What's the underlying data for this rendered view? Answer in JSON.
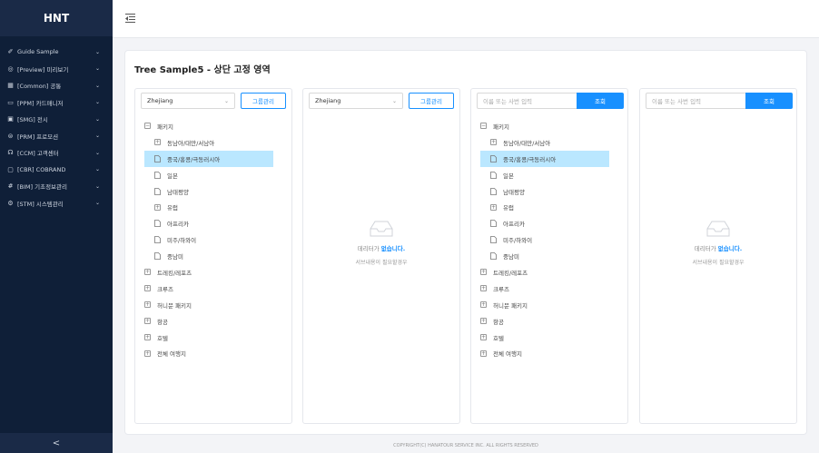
{
  "app": {
    "brand": "HNT",
    "collapse_glyph": "<"
  },
  "sidebar": {
    "items": [
      {
        "icon": "✐",
        "label": "Guide Sample"
      },
      {
        "icon": "◎",
        "label": "[Preview] 미리보기"
      },
      {
        "icon": "▦",
        "label": "[Common] 공통"
      },
      {
        "icon": "▭",
        "label": "[PPM] 카드매니저"
      },
      {
        "icon": "▣",
        "label": "[SMG] 전시"
      },
      {
        "icon": "⊜",
        "label": "[PRM] 프로모션"
      },
      {
        "icon": "☊",
        "label": "[CCM] 고객센터"
      },
      {
        "icon": "▢",
        "label": "[CBR] COBRAND"
      },
      {
        "icon": "#",
        "label": "[BIM] 기초정보관리"
      },
      {
        "icon": "⚙",
        "label": "[STM] 시스템관리"
      }
    ]
  },
  "page": {
    "title": "Tree Sample5 - 상단 고정 영역"
  },
  "panels": {
    "p1": {
      "select_value": "Zhejiang",
      "group_button": "그룹관리"
    },
    "p2": {
      "select_value": "Zhejiang",
      "group_button": "그룹관리"
    },
    "p3": {
      "search_placeholder": "이름 또는 사번 입력",
      "search_button": "조회"
    },
    "p4": {
      "search_placeholder": "이름 또는 사번 입력",
      "search_button": "조회"
    }
  },
  "tree": {
    "root": "패키지",
    "regions": [
      "동남아/대만/서남아",
      "중국/홍콩/극동러시아",
      "일본",
      "남태평양",
      "유럽",
      "아프리카",
      "미주/하와이",
      "중남미"
    ],
    "others": [
      "트레킹/레포츠",
      "크루즈",
      "허니문 패키지",
      "항공",
      "호텔",
      "전체 여행지"
    ]
  },
  "empty_state": {
    "prefix": "데리터가 ",
    "emphasis": "없습니다.",
    "sub": "서브내용이 필요할경우"
  },
  "footer": {
    "text": "COPYRIGHT(C) HANATOUR SERVICE INC. ALL RIGHTS RESERVED"
  }
}
